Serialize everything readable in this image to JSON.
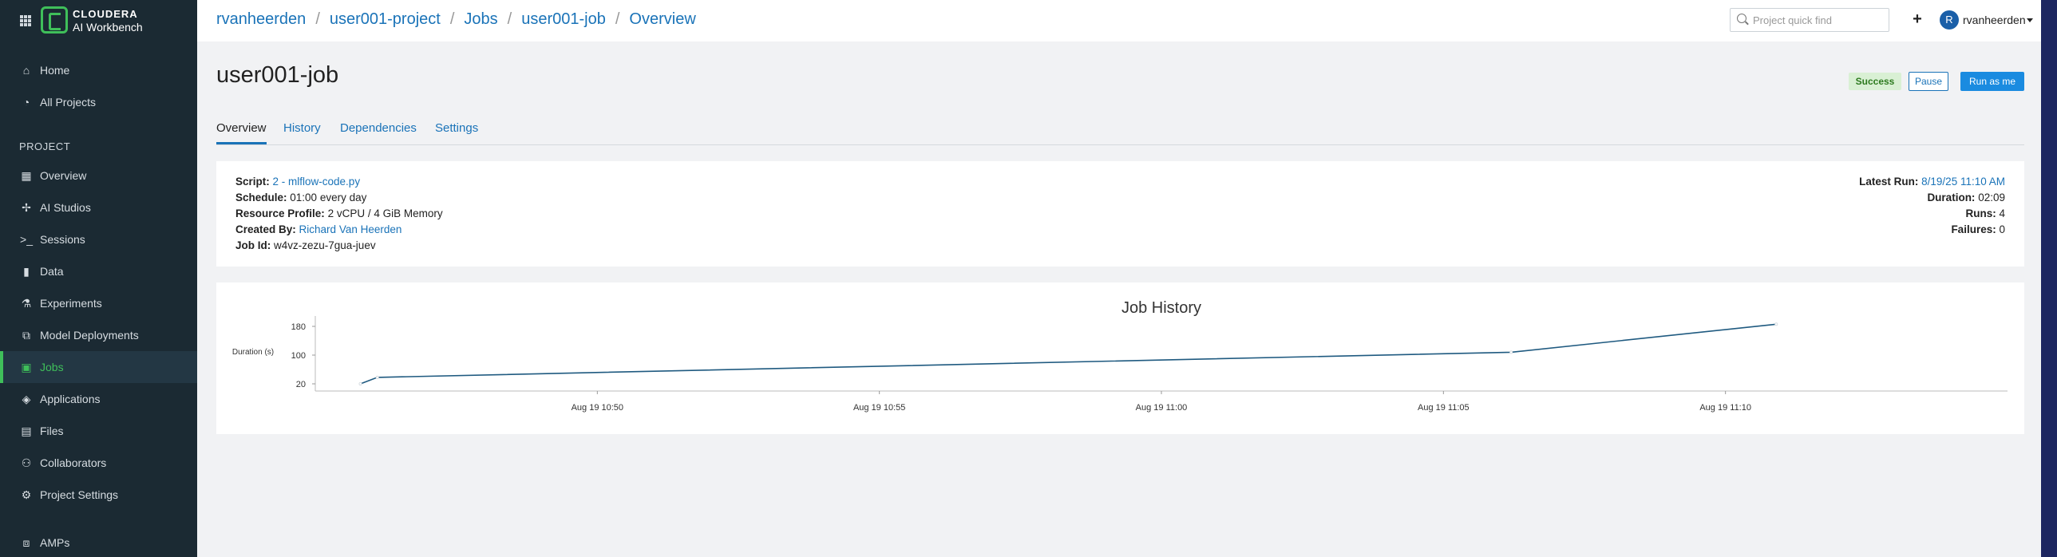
{
  "brand": {
    "line1": "CLOUDERA",
    "line2": "AI Workbench"
  },
  "sidebar": {
    "top_items": [
      {
        "label": "Home",
        "icon": "home-icon"
      },
      {
        "label": "All Projects",
        "icon": "projects-icon"
      }
    ],
    "section_label": "PROJECT",
    "items": [
      {
        "label": "Overview",
        "icon": "overview-icon"
      },
      {
        "label": "AI Studios",
        "icon": "ai-studios-icon"
      },
      {
        "label": "Sessions",
        "icon": "terminal-icon"
      },
      {
        "label": "Data",
        "icon": "bar-chart-icon"
      },
      {
        "label": "Experiments",
        "icon": "flask-icon"
      },
      {
        "label": "Model Deployments",
        "icon": "deployment-icon"
      },
      {
        "label": "Jobs",
        "icon": "calendar-icon",
        "active": true
      },
      {
        "label": "Applications",
        "icon": "layers-icon"
      },
      {
        "label": "Files",
        "icon": "file-icon"
      },
      {
        "label": "Collaborators",
        "icon": "users-icon"
      },
      {
        "label": "Project Settings",
        "icon": "gear-icon"
      }
    ],
    "bottom_item": {
      "label": "AMPs",
      "icon": "amps-icon"
    }
  },
  "breadcrumb": [
    "rvanheerden",
    "user001-project",
    "Jobs",
    "user001-job",
    "Overview"
  ],
  "search": {
    "placeholder": "Project quick find"
  },
  "user": {
    "initial": "R",
    "name": "rvanheerden"
  },
  "job": {
    "title": "user001-job",
    "status": "Success",
    "pause_label": "Pause",
    "run_label": "Run as me"
  },
  "tabs": [
    "Overview",
    "History",
    "Dependencies",
    "Settings"
  ],
  "details": {
    "script_label": "Script:",
    "script_value": "2 - mlflow-code.py",
    "schedule_label": "Schedule:",
    "schedule_value": "01:00 every day",
    "resource_label": "Resource Profile:",
    "resource_value": "2 vCPU / 4 GiB Memory",
    "created_label": "Created By:",
    "created_value": "Richard Van Heerden",
    "jobid_label": "Job Id:",
    "jobid_value": "w4vz-zezu-7gua-juev",
    "latest_label": "Latest Run:",
    "latest_value": "8/19/25 11:10 AM",
    "duration_label": "Duration:",
    "duration_value": "02:09",
    "runs_label": "Runs:",
    "runs_value": "4",
    "failures_label": "Failures:",
    "failures_value": "0"
  },
  "colors": {
    "accent": "#1a73b8",
    "sidebar_bg": "#1b2a33",
    "active_green": "#3fbf5a",
    "line": "#1f5a80"
  },
  "chart_data": {
    "type": "line",
    "title": "Job History",
    "xlabel": "",
    "ylabel": "Duration (s)",
    "ylim": [
      0,
      200
    ],
    "yticks": [
      20,
      100,
      180
    ],
    "xticks": [
      "Aug 19 10:50",
      "Aug 19 10:55",
      "Aug 19 11:00",
      "Aug 19 11:05",
      "Aug 19 11:10"
    ],
    "xrange_minutes": [
      -5,
      25
    ],
    "series": [
      {
        "points": [
          {
            "t": -4.2,
            "y": 20
          },
          {
            "t": -3.9,
            "y": 38
          },
          {
            "t": 16.2,
            "y": 108
          },
          {
            "t": 20.9,
            "y": 186
          }
        ]
      }
    ],
    "grid": false,
    "legend": "none"
  }
}
